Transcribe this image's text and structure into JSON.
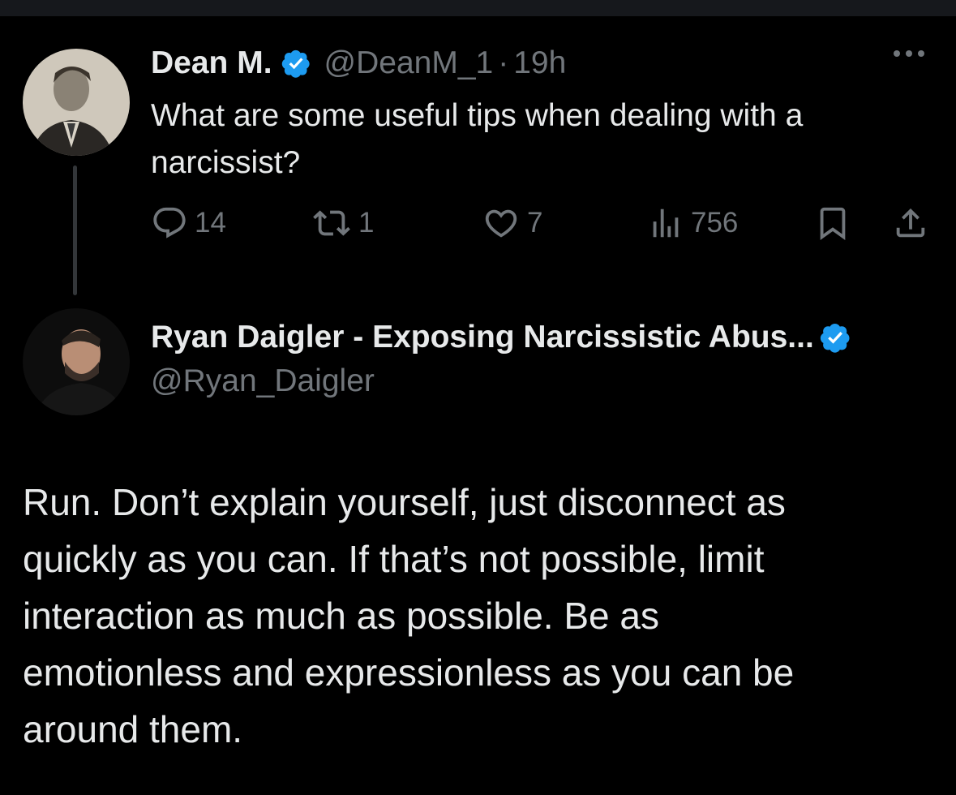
{
  "parent_tweet": {
    "display_name": "Dean M.",
    "handle": "@DeanM_1",
    "separator": "·",
    "time": "19h",
    "text_line1": "What are some useful tips when dealing with a",
    "text_line2": "narcissist?",
    "stats": {
      "replies": "14",
      "reposts": "1",
      "likes": "7",
      "views": "756"
    }
  },
  "reply_tweet": {
    "display_name": "Ryan Daigler - Exposing Narcissistic Abus...",
    "handle": "@Ryan_Daigler",
    "text_lines": [
      "Run. Don’t explain yourself, just disconnect as",
      "quickly as you can. If that’s not possible, limit",
      "interaction as much as possible. Be as",
      "emotionless and expressionless as you can be",
      "around them."
    ]
  },
  "colors": {
    "background": "#000000",
    "text_primary": "#e7e9ea",
    "text_secondary": "#71767b",
    "verified_blue": "#1d9bf0",
    "thread_line": "#333639"
  },
  "icons": [
    "verified-badge-icon",
    "reply-icon",
    "repost-icon",
    "like-icon",
    "views-icon",
    "bookmark-icon",
    "share-icon",
    "more-icon"
  ]
}
